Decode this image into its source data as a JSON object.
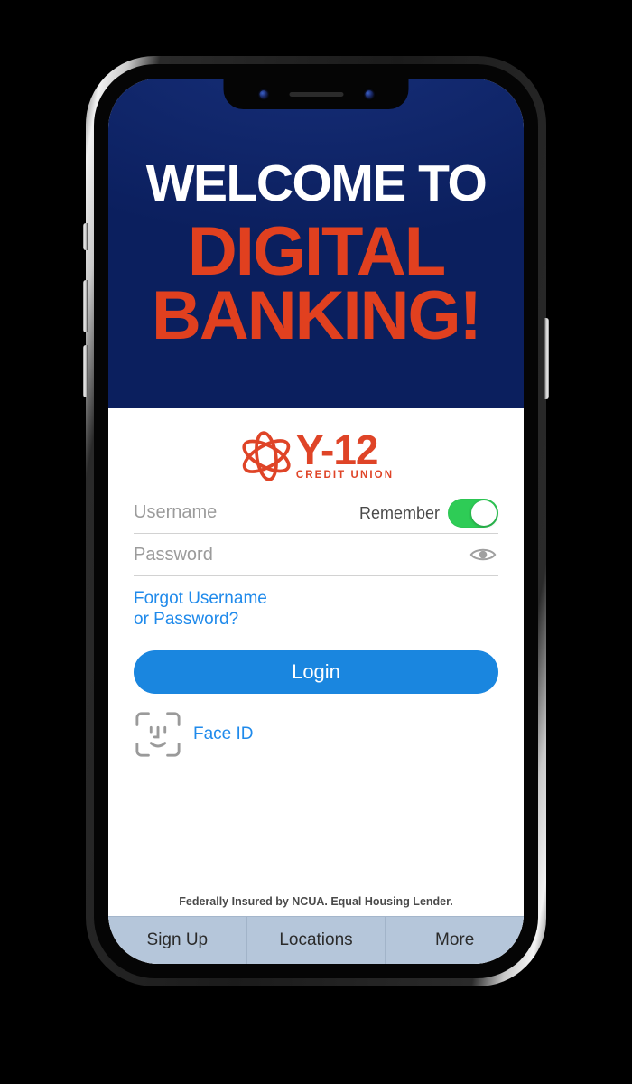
{
  "banner": {
    "line1": "WELCOME TO",
    "line2": "DIGITAL",
    "line3": "BANKING!",
    "bg_color": "#0b1f5e",
    "line1_color": "#ffffff",
    "accent_color": "#e1401f"
  },
  "logo": {
    "name": "Y-12",
    "subtitle": "CREDIT UNION",
    "color": "#df4427",
    "icon": "atom-icon"
  },
  "form": {
    "username_placeholder": "Username",
    "username_value": "",
    "password_placeholder": "Password",
    "password_value": "",
    "remember_label": "Remember",
    "remember_on": true,
    "remember_on_color": "#2ecc56",
    "show_password_icon": "eye-icon",
    "forgot_link": "Forgot Username\nor Password?",
    "forgot_link_line1": "Forgot Username",
    "forgot_link_line2": "or Password?",
    "login_label": "Login",
    "login_color": "#1a86df",
    "link_color": "#1f8aeb",
    "faceid_label": "Face ID",
    "faceid_icon": "face-id-icon"
  },
  "disclaimer": "Federally Insured by NCUA. Equal Housing Lender.",
  "tabbar": {
    "bg_color": "#b5c6da",
    "tabs": [
      {
        "label": "Sign Up"
      },
      {
        "label": "Locations"
      },
      {
        "label": "More"
      }
    ]
  },
  "device": {
    "type": "smartphone",
    "notch": true,
    "cameras": 2,
    "speaker": "earpiece-speaker"
  }
}
